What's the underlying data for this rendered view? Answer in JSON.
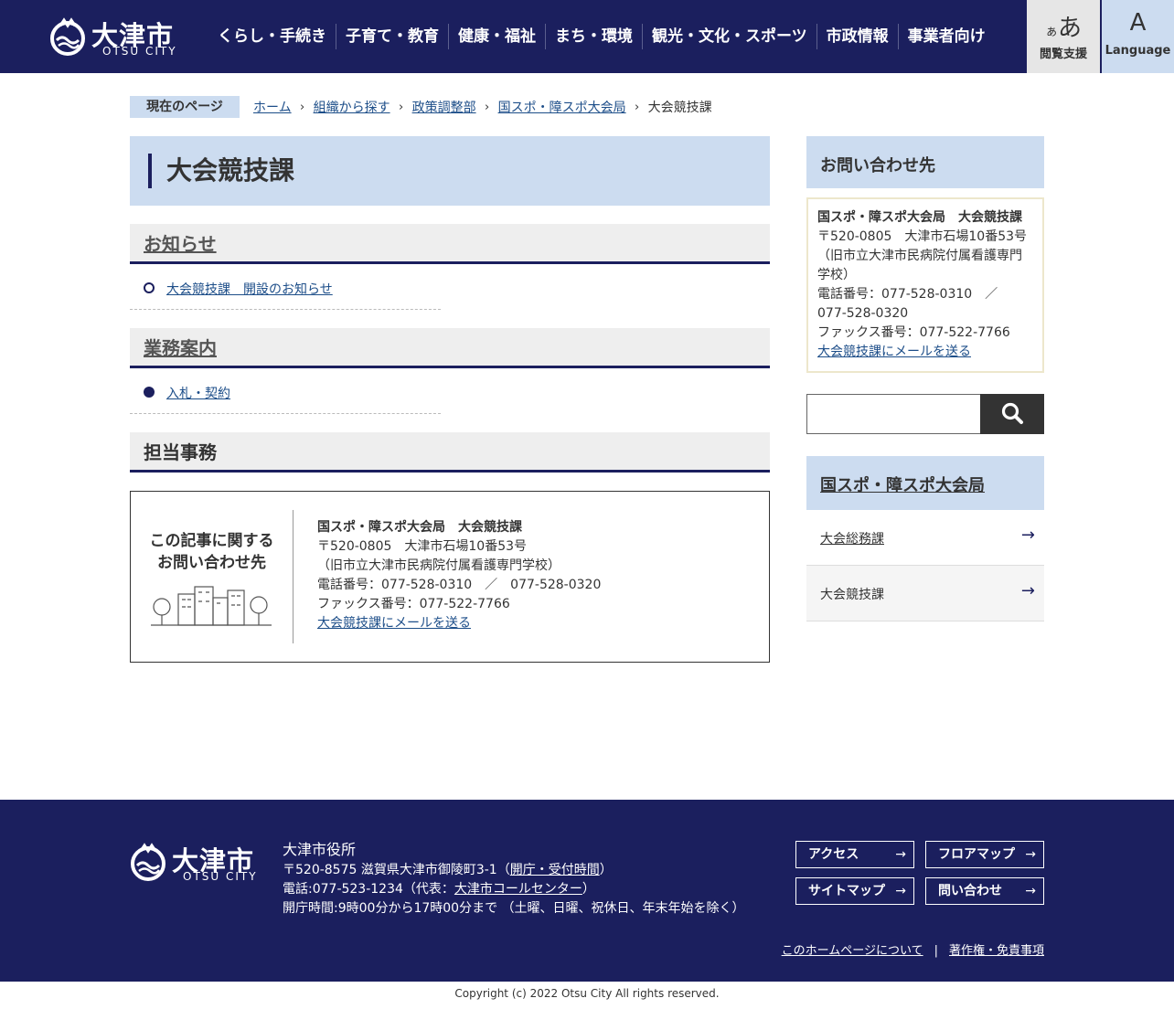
{
  "header": {
    "logo_text": "大津市",
    "logo_sub": "OTSU CITY",
    "nav": [
      "くらし・手続き",
      "子育て・教育",
      "健康・福祉",
      "まち・環境",
      "観光・文化・スポーツ",
      "市政情報",
      "事業者向け"
    ],
    "access": {
      "glyph_small": "ぁ",
      "glyph_big": "あ",
      "label": "閲覧支援"
    },
    "language": {
      "glyph": "A",
      "label": "Language"
    }
  },
  "breadcrumb": {
    "current_label": "現在のページ",
    "items": [
      "ホーム",
      "組織から探す",
      "政策調整部",
      "国スポ・障スポ大会局"
    ],
    "current": "大会競技課"
  },
  "page": {
    "title": "大会競技課",
    "news_heading": "お知らせ",
    "news_items": [
      "大会競技課　開設のお知らせ"
    ],
    "business_heading": "業務案内",
    "business_items": [
      "入札・契約"
    ],
    "duties_heading": "担当事務"
  },
  "contact_box": {
    "title_line1": "この記事に関する",
    "title_line2": "お問い合わせ先",
    "org": "国スポ・障スポ大会局　大会競技課",
    "address": "〒520-0805　大津市石場10番53号",
    "address_note": "（旧市立大津市民病院付属看護専門学校）",
    "phone": "電話番号：077-528-0310　／　077-528-0320",
    "fax": "ファックス番号：077-522-7766",
    "mail_link": "大会競技課にメールを送る"
  },
  "sidebar": {
    "contact_heading": "お問い合わせ先",
    "org": "国スポ・障スポ大会局　大会競技課",
    "address": "〒520-0805　大津市石場10番53号",
    "address_note": "（旧市立大津市民病院付属看護専門学校）",
    "phone": "電話番号：077-528-0310　／　077-528-0320",
    "fax": "ファックス番号：077-522-7766",
    "mail_link": "大会競技課にメールを送る",
    "search_placeholder": "",
    "section_heading": "国スポ・障スポ大会局",
    "links": [
      {
        "label": "大会総務課",
        "arrow": "→"
      },
      {
        "label": "大会競技課",
        "arrow": "→"
      }
    ]
  },
  "footer": {
    "logo_text": "大津市",
    "logo_sub": "OTSU CITY",
    "name": "大津市役所",
    "address_prefix": "〒520-8575 滋賀県大津市御陵町3-1（",
    "hours_link": "開庁・受付時間",
    "address_suffix": "）",
    "phone_prefix": "電話:077-523-1234（代表：",
    "callcenter_link": "大津市コールセンター",
    "phone_suffix": "）",
    "open_hours": "開庁時間:9時00分から17時00分まで （土曜、日曜、祝休日、年末年始を除く）",
    "buttons": [
      {
        "label": "アクセス",
        "arrow": "→"
      },
      {
        "label": "フロアマップ",
        "arrow": "→"
      },
      {
        "label": "サイトマップ",
        "arrow": "→"
      },
      {
        "label": "問い合わせ",
        "arrow": "→"
      }
    ],
    "about_link": "このホームページについて",
    "separator": "|",
    "copyright_link": "著作権・免責事項",
    "copyright": "Copyright (c) 2022 Otsu City All rights reserved."
  },
  "colors": {
    "navy": "#1b1f5e",
    "light_blue": "#ccdcf0",
    "link": "#1d4e89"
  }
}
